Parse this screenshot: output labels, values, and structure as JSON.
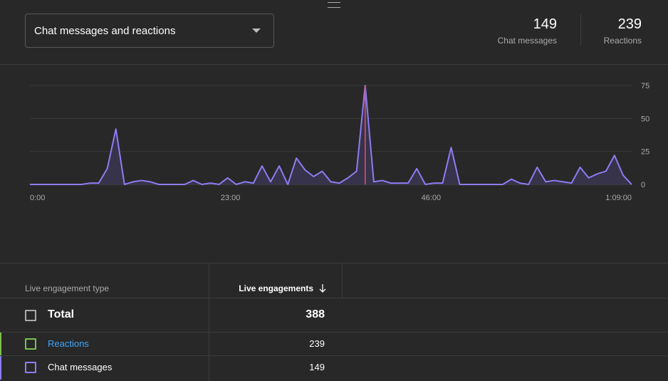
{
  "header": {
    "metric_dropdown": {
      "selected": "Chat messages and reactions"
    },
    "stats": [
      {
        "value": "149",
        "label": "Chat messages"
      },
      {
        "value": "239",
        "label": "Reactions"
      }
    ]
  },
  "chart_data": {
    "type": "area",
    "series": [
      {
        "name": "Chat messages and reactions",
        "color": "#8c7df2",
        "values": [
          0,
          0,
          0,
          0,
          0,
          0,
          0,
          1,
          1,
          12,
          42,
          0,
          2,
          3,
          2,
          0,
          0,
          0,
          0,
          3,
          0,
          1,
          0,
          5,
          0,
          2,
          1,
          14,
          2,
          14,
          0,
          20,
          11,
          6,
          10,
          2,
          1,
          5,
          10,
          75,
          2,
          3,
          1,
          1,
          1,
          12,
          0,
          1,
          1,
          28,
          0,
          0,
          0,
          0,
          0,
          0,
          4,
          1,
          0,
          13,
          2,
          3,
          2,
          1,
          13,
          5,
          8,
          10,
          22,
          7,
          0
        ]
      }
    ],
    "x_range": [
      0,
      69
    ],
    "y_range": [
      0,
      75
    ],
    "x_ticks": [
      {
        "value": 0,
        "label": "0:00"
      },
      {
        "value": 23,
        "label": "23:00"
      },
      {
        "value": 46,
        "label": "46:00"
      },
      {
        "value": 69,
        "label": "1:09:00"
      }
    ],
    "y_ticks": [
      0,
      25,
      50,
      75
    ],
    "peak_marker": {
      "x": 39,
      "color": "#e0506a"
    },
    "grid": true
  },
  "table": {
    "headers": {
      "type": "Live engagement type",
      "engagements": "Live engagements"
    },
    "total": {
      "label": "Total",
      "value": "388"
    },
    "rows": [
      {
        "label": "Reactions",
        "value": "239",
        "color": "#7cc14b",
        "label_color": "#3ea6ff"
      },
      {
        "label": "Chat messages",
        "value": "149",
        "color": "#8c7df2",
        "label_color": "#ffffff"
      }
    ]
  }
}
